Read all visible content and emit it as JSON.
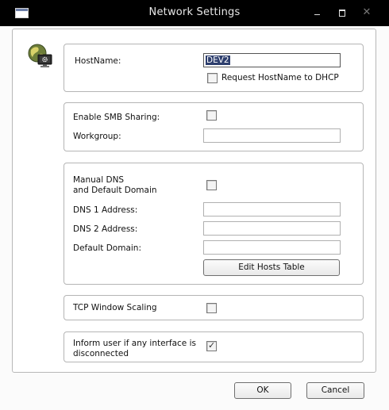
{
  "window": {
    "title": "Network Settings",
    "close_glyph": "✕"
  },
  "hostname": {
    "label": "HostName:",
    "value": "DEV2",
    "request_dhcp_label": "Request HostName to DHCP",
    "request_dhcp_checked": false
  },
  "smb": {
    "enable_label": "Enable SMB Sharing:",
    "enable_checked": false,
    "workgroup_label": "Workgroup:",
    "workgroup_value": ""
  },
  "dns": {
    "manual_label_line1": "Manual DNS",
    "manual_label_line2": "and Default Domain",
    "manual_checked": false,
    "dns1_label": "DNS 1 Address:",
    "dns1_value": "",
    "dns2_label": "DNS 2 Address:",
    "dns2_value": "",
    "domain_label": "Default Domain:",
    "domain_value": "",
    "edit_hosts_label": "Edit Hosts Table"
  },
  "tcp": {
    "label": "TCP Window Scaling",
    "checked": false
  },
  "inform": {
    "label_line1": "Inform user if any interface is",
    "label_line2": "disconnected",
    "checked": true,
    "tick_glyph": "✓"
  },
  "footer": {
    "ok_label": "OK",
    "cancel_label": "Cancel"
  },
  "icons": {
    "network": "network-globe-monitor-icon"
  },
  "colors": {
    "titlebar": "#000000",
    "selection": "#2e3f6e"
  }
}
